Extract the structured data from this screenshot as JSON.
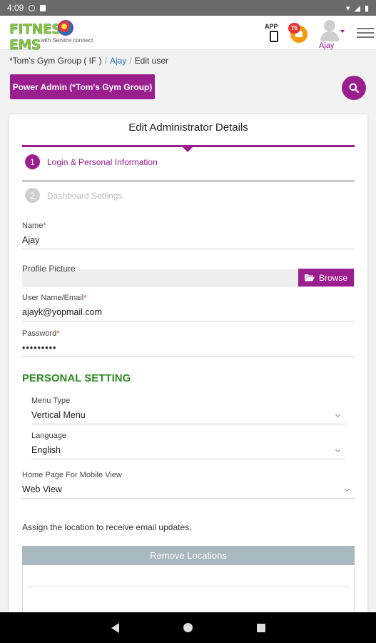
{
  "status_bar": {
    "time": "4:09"
  },
  "app_bar": {
    "logo_text": "FITNESS  EMS",
    "logo_subtitle": "with Service connect",
    "app_icon_label": "APP",
    "notification_count": "75",
    "user_name": "Ajay"
  },
  "breadcrumb": {
    "root": "*Tom's Gym Group ( IF )",
    "middle": "Ajay",
    "current": "Edit user"
  },
  "role_button": "Power Admin (*Tom's Gym Group)",
  "form": {
    "title": "Edit Administrator Details",
    "steps": [
      {
        "number": "1",
        "label": "Login & Personal Information"
      },
      {
        "number": "2",
        "label": "Dashboard Settings"
      }
    ],
    "name": {
      "label": "Name",
      "value": "Ajay"
    },
    "profile_picture": {
      "label": "Profile Picture",
      "browse_label": "Browse"
    },
    "email": {
      "label": "User Name/Email",
      "value": "ajayk@yopmail.com"
    },
    "password": {
      "label": "Password",
      "value": "•••••••••"
    },
    "required_mark": "*"
  },
  "personal_setting": {
    "heading": "PERSONAL SETTING",
    "menu_type": {
      "label": "Menu Type",
      "value": "Vertical Menu"
    },
    "language": {
      "label": "Language",
      "value": "English"
    },
    "home_page": {
      "label": "Home Page For Mobile View",
      "value": "Web View"
    }
  },
  "locations": {
    "instruction": "Assign the location to receive email updates.",
    "header": "Remove Locations"
  },
  "colors": {
    "primary": "#9b1e8f",
    "section_green": "#2e8b22",
    "link_blue": "#1e73be",
    "table_header": "#a8b8c0"
  }
}
